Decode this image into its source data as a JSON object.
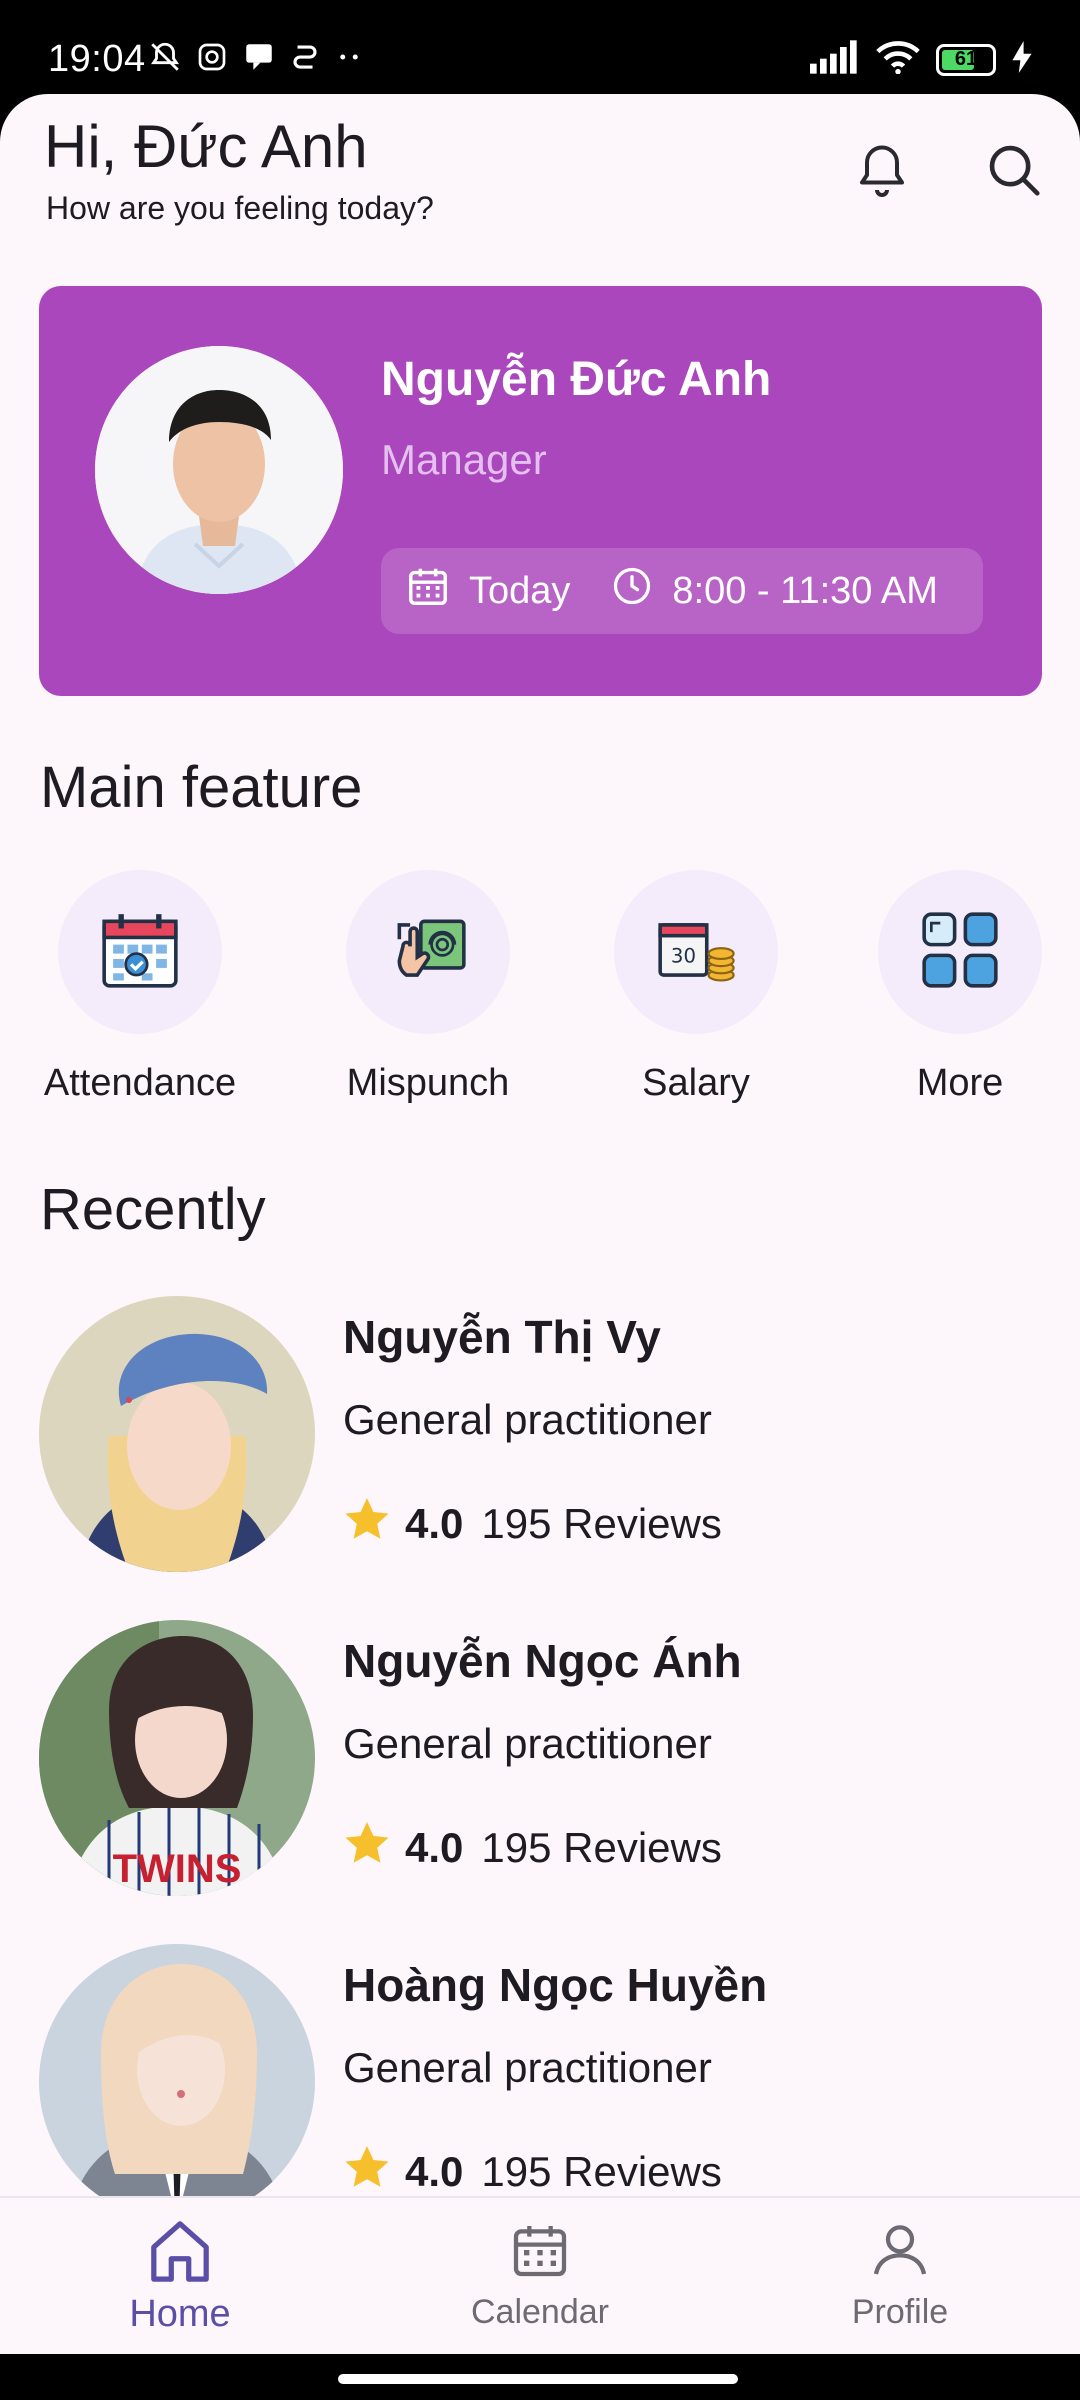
{
  "status_bar": {
    "time": "19:04",
    "battery": "61",
    "icons": [
      "bell-off-icon",
      "instagram-icon",
      "message-icon",
      "app-icon",
      "more-dots-icon",
      "signal-icon",
      "wifi-icon",
      "battery-icon",
      "charging-icon"
    ]
  },
  "header": {
    "greeting": "Hi, Đức Anh",
    "subtitle": "How are you feeling today?"
  },
  "profile": {
    "name": "Nguyễn Đức Anh",
    "role": "Manager",
    "day": "Today",
    "time_range": "8:00 - 11:30 AM"
  },
  "main_feature": {
    "title": "Main feature",
    "items": [
      {
        "label": "Attendance",
        "icon": "attendance-calendar-icon"
      },
      {
        "label": "Mispunch",
        "icon": "fingerprint-icon"
      },
      {
        "label": "Salary",
        "icon": "salary-icon"
      },
      {
        "label": "More",
        "icon": "grid-icon"
      }
    ]
  },
  "recently": {
    "title": "Recently",
    "items": [
      {
        "name": "Nguyễn Thị Vy",
        "role": "General practitioner",
        "rating": "4.0",
        "reviews": "195 Reviews"
      },
      {
        "name": "Nguyễn Ngọc Ánh",
        "role": "General practitioner",
        "rating": "4.0",
        "reviews": "195 Reviews"
      },
      {
        "name": "Hoàng Ngọc Huyền",
        "role": "General practitioner",
        "rating": "4.0",
        "reviews": "195 Reviews"
      }
    ]
  },
  "nav": {
    "items": [
      {
        "label": "Home",
        "icon": "home-icon",
        "active": true
      },
      {
        "label": "Calendar",
        "icon": "calendar-icon",
        "active": false
      },
      {
        "label": "Profile",
        "icon": "profile-icon",
        "active": false
      }
    ]
  },
  "colors": {
    "card": "#aa47bc",
    "accent": "#5b4ea7",
    "background": "#fdf7fc",
    "star": "#f5c02c"
  }
}
